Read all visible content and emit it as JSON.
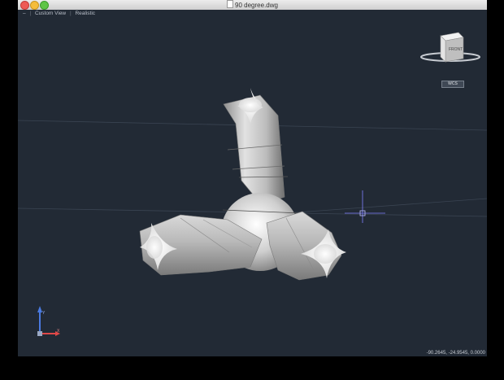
{
  "window": {
    "title": "90 degree.dwg"
  },
  "view_controls": {
    "menu": "–",
    "view": "Custom View",
    "style": "Realistic"
  },
  "viewcube": {
    "face_label": "FRONT"
  },
  "ucs": {
    "label": "WCS"
  },
  "axis_labels": {
    "x": "X",
    "y": "Y"
  },
  "status": {
    "coordinates": "-90.2645, -24.9545, 0.0000"
  },
  "colors": {
    "viewport_bg": "#222a35",
    "model": "#d8d8d8",
    "crosshair": "#8080ff",
    "ucs_x": "#e04848",
    "ucs_y": "#4a7ae0"
  }
}
